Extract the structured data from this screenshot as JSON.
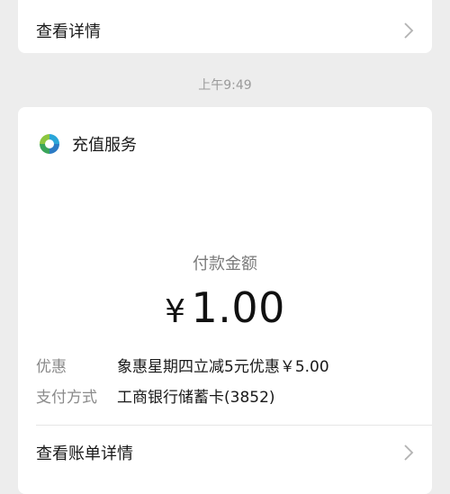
{
  "top_card": {
    "view_details": "查看详情"
  },
  "timestamp": "上午9:49",
  "service": {
    "name": "充值服务",
    "logo_icon": "recharge-service-logo-icon"
  },
  "payment": {
    "amount_label": "付款金额",
    "currency": "¥",
    "amount": "1.00"
  },
  "details": [
    {
      "key": "优惠",
      "value": "象惠星期四立减5元优惠￥5.00"
    },
    {
      "key": "支付方式",
      "value": "工商银行储蓄卡(3852)"
    }
  ],
  "bill_details_link": "查看账单详情",
  "colors": {
    "background": "#ededed",
    "card": "#ffffff",
    "muted": "#8a8a8a"
  }
}
